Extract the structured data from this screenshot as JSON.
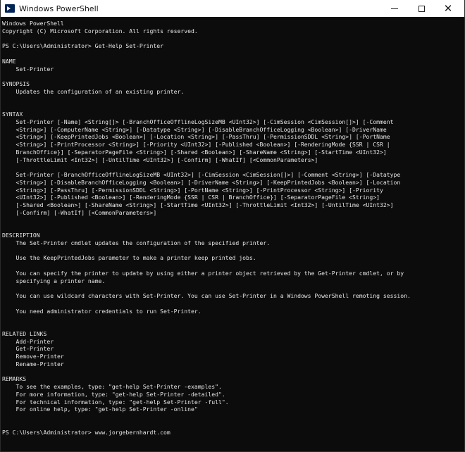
{
  "window": {
    "title": "Windows PowerShell",
    "buttons": {
      "minimize": "—",
      "maximize": "☐",
      "close": "✕"
    }
  },
  "console": {
    "lines": [
      "Windows PowerShell",
      "Copyright (C) Microsoft Corporation. All rights reserved.",
      "",
      "PS C:\\Users\\Administrator> Get-Help Set-Printer",
      "",
      "NAME",
      "    Set-Printer",
      "",
      "SYNOPSIS",
      "    Updates the configuration of an existing printer.",
      "",
      "",
      "SYNTAX",
      "    Set-Printer [-Name] <String[]> [-BranchOfficeOfflineLogSizeMB <UInt32>] [-CimSession <CimSession[]>] [-Comment",
      "    <String>] [-ComputerName <String>] [-Datatype <String>] [-DisableBranchOfficeLogging <Boolean>] [-DriverName",
      "    <String>] [-KeepPrintedJobs <Boolean>] [-Location <String>] [-PassThru] [-PermissionSDDL <String>] [-PortName",
      "    <String>] [-PrintProcessor <String>] [-Priority <UInt32>] [-Published <Boolean>] [-RenderingMode {SSR | CSR |",
      "    BranchOffice}] [-SeparatorPageFile <String>] [-Shared <Boolean>] [-ShareName <String>] [-StartTime <UInt32>]",
      "    [-ThrottleLimit <Int32>] [-UntilTime <UInt32>] [-Confirm] [-WhatIf] [<CommonParameters>]",
      "",
      "    Set-Printer [-BranchOfficeOfflineLogSizeMB <UInt32>] [-CimSession <CimSession[]>] [-Comment <String>] [-Datatype",
      "    <String>] [-DisableBranchOfficeLogging <Boolean>] [-DriverName <String>] [-KeepPrintedJobs <Boolean>] [-Location",
      "    <String>] [-PassThru] [-PermissionSDDL <String>] [-PortName <String>] [-PrintProcessor <String>] [-Priority",
      "    <UInt32>] [-Published <Boolean>] [-RenderingMode {SSR | CSR | BranchOffice}] [-SeparatorPageFile <String>]",
      "    [-Shared <Boolean>] [-ShareName <String>] [-StartTime <UInt32>] [-ThrottleLimit <Int32>] [-UntilTime <UInt32>]",
      "    [-Confirm] [-WhatIf] [<CommonParameters>]",
      "",
      "",
      "DESCRIPTION",
      "    The Set-Printer cmdlet updates the configuration of the specified printer.",
      "",
      "    Use the KeepPrintedJobs parameter to make a printer keep printed jobs.",
      "",
      "    You can specify the printer to update by using either a printer object retrieved by the Get-Printer cmdlet, or by",
      "    specifying a printer name.",
      "",
      "    You can use wildcard characters with Set-Printer. You can use Set-Printer in a Windows PowerShell remoting session.",
      "",
      "    You need administrator credentials to run Set-Printer.",
      "",
      "",
      "RELATED LINKS",
      "    Add-Printer",
      "    Get-Printer",
      "    Remove-Printer",
      "    Rename-Printer",
      "",
      "REMARKS",
      "    To see the examples, type: \"get-help Set-Printer -examples\".",
      "    For more information, type: \"get-help Set-Printer -detailed\".",
      "    For technical information, type: \"get-help Set-Printer -full\".",
      "    For online help, type: \"get-help Set-Printer -online\"",
      "",
      "",
      "PS C:\\Users\\Administrator> www.jorgebernhardt.com"
    ]
  }
}
